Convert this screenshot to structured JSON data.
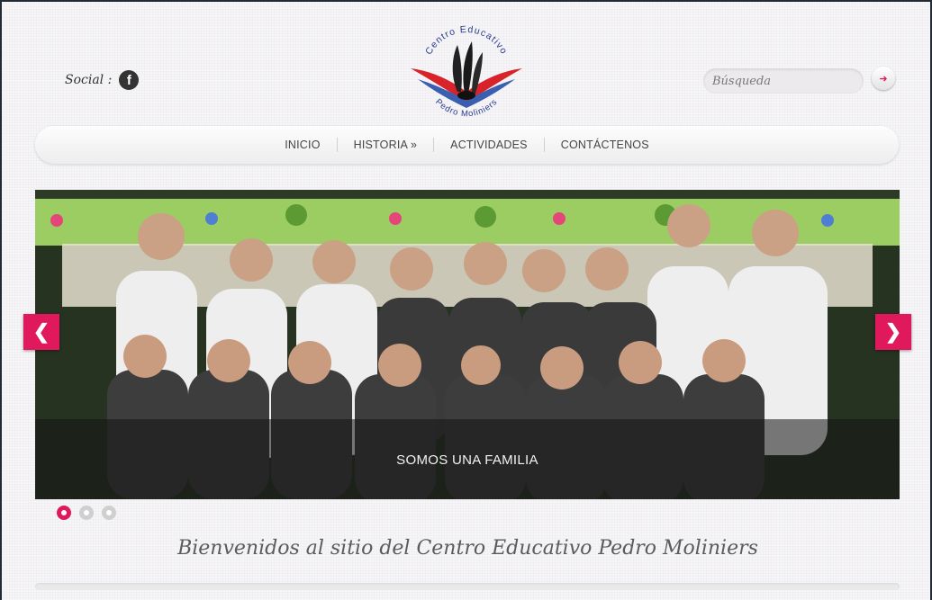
{
  "header": {
    "social_label": "Social :",
    "social_icons": [
      "facebook-icon"
    ],
    "logo": {
      "top_text": "Centro Educativo",
      "bottom_text": "Pedro Moliniers",
      "colors": {
        "ring": "#2b3b8f",
        "red": "#d8232a",
        "blue": "#3b5fb0",
        "feathers": "#222222"
      }
    },
    "search": {
      "placeholder": "Búsqueda",
      "button_icon": "arrow-right-icon"
    }
  },
  "nav": {
    "items": [
      {
        "label": "INICIO"
      },
      {
        "label": "HISTORIA »"
      },
      {
        "label": "ACTIVIDADES"
      },
      {
        "label": "CONTÁCTENOS"
      }
    ]
  },
  "slider": {
    "caption": "SOMOS UNA FAMILIA",
    "prev_icon": "chevron-left-icon",
    "next_icon": "chevron-right-icon",
    "prev_glyph": "❮",
    "next_glyph": "❯",
    "slide_count": 3,
    "active_slide": 1
  },
  "welcome": {
    "text": "Bienvenidos al sitio del Centro Educativo Pedro Moliniers"
  },
  "colors": {
    "accent": "#e0195c"
  }
}
